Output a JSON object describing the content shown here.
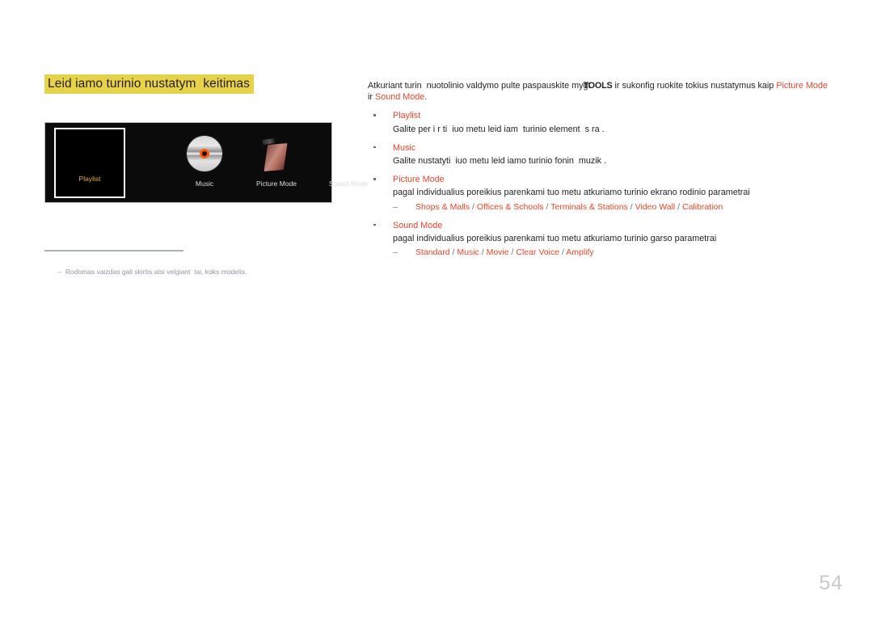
{
  "document": {
    "page_number": "54"
  },
  "left": {
    "section_title": "Leid iamo turinio nustatym  keitimas",
    "panel": {
      "tiles": [
        {
          "label": "Playlist",
          "icon": "playlist-thumbnail",
          "selected": true
        },
        {
          "label": "Music",
          "icon": "cd-disc-icon",
          "selected": false
        },
        {
          "label": "Picture Mode",
          "icon": "screen-panel-icon",
          "selected": false
        },
        {
          "label": "Sound Mode",
          "icon": "none",
          "selected": false
        }
      ]
    },
    "footnote": {
      "dash": "–",
      "text": "Rodomas vaizdas gali skirtis atsi velgiant  tai, koks modelis."
    }
  },
  "right": {
    "lead": {
      "part1": "Atkuriant turin  nuotolinio valdymo pulte paspauskite mygt",
      "tools": "TOOLS",
      "part2": " ir sukonfig ruokite tokius nustatymus kaip ",
      "link1": "Picture Mode",
      "conj": " ir ",
      "link2": "Sound Mode",
      "period": "."
    },
    "bullets": [
      {
        "title": "Playlist",
        "desc": "Galite per i r ti  iuo metu leid iam  turinio element  s ra .",
        "options": null
      },
      {
        "title": "Music",
        "desc": "Galite nustatyti  iuo metu leid iamo turinio fonin  muzik .",
        "options": null
      },
      {
        "title": "Picture Mode",
        "desc": "pagal individualius poreikius parenkami tuo metu atkuriamo turinio ekrano rodinio parametrai",
        "options": {
          "dash": "–",
          "items": [
            "Shops & Malls",
            "Offices & Schools",
            "Terminals & Stations",
            "Video Wall",
            "Calibration"
          ],
          "separator": " / "
        }
      },
      {
        "title": "Sound Mode",
        "desc": "pagal individualius poreikius parenkami tuo metu atkuriamo turinio garso parametrai",
        "options": {
          "dash": "–",
          "items": [
            "Standard",
            "Music",
            "Movie",
            "Clear Voice",
            "Amplify"
          ],
          "separator": " / "
        }
      }
    ]
  },
  "colors": {
    "highlight": "#e6d24b",
    "accent_red": "#e8452b",
    "footnote_gray": "#8d94a3",
    "page_number_gray": "#c7c9cc",
    "selected_tile_label": "#e4b23c"
  }
}
